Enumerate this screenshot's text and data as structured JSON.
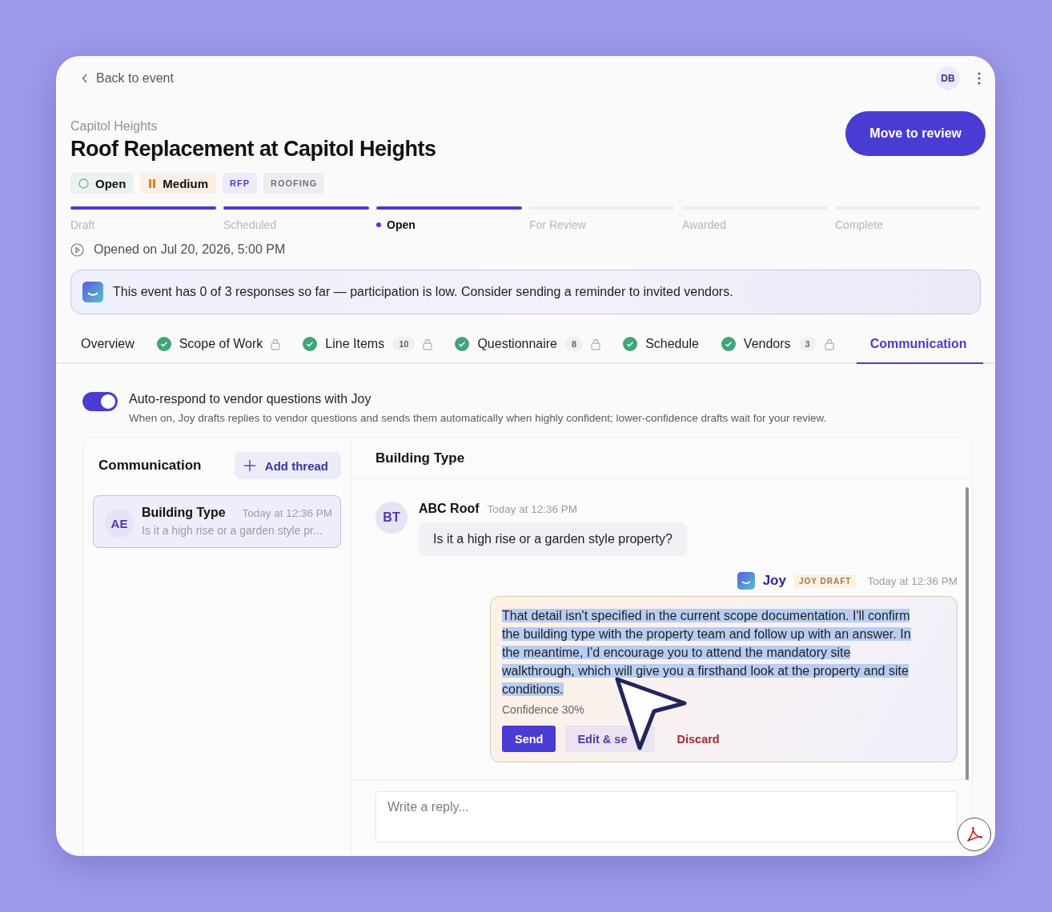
{
  "header": {
    "back": "Back to event",
    "avatar": "DB"
  },
  "event": {
    "breadcrumb": "Capitol Heights",
    "title": "Roof Replacement at Capitol Heights",
    "action": "Move to review"
  },
  "badges": [
    {
      "kind": "status",
      "label": "Open"
    },
    {
      "kind": "priority",
      "label": "Medium"
    },
    {
      "kind": "type",
      "label": "RFP"
    },
    {
      "kind": "category",
      "label": "ROOFING"
    }
  ],
  "stages": [
    {
      "label": "Draft",
      "done": true,
      "selected": false
    },
    {
      "label": "Scheduled",
      "done": true,
      "selected": false
    },
    {
      "label": "Open",
      "done": true,
      "selected": true
    },
    {
      "label": "For Review",
      "done": false,
      "selected": false
    },
    {
      "label": "Awarded",
      "done": false,
      "selected": false
    },
    {
      "label": "Complete",
      "done": false,
      "selected": false
    }
  ],
  "opened": "Opened on Jul 20, 2026, 5:00 PM",
  "alert": "This event has 0 of 3 responses so far — participation is low. Consider sending a reminder to invited vendors.",
  "tabs": [
    {
      "label": "Overview",
      "complete": false,
      "locked": false,
      "selected": false
    },
    {
      "label": "Scope of Work",
      "complete": true,
      "locked": true,
      "selected": false
    },
    {
      "label": "Line Items",
      "complete": true,
      "count": "10",
      "locked": true,
      "selected": false
    },
    {
      "label": "Questionnaire",
      "complete": true,
      "count": "8",
      "locked": true,
      "selected": false
    },
    {
      "label": "Schedule",
      "complete": true,
      "locked": false,
      "selected": false
    },
    {
      "label": "Vendors",
      "complete": true,
      "count": "3",
      "locked": true,
      "selected": false
    },
    {
      "label": "Communication",
      "complete": false,
      "locked": false,
      "selected": true
    }
  ],
  "auto_respond": {
    "on": true,
    "label": "Auto-respond to vendor questions with Joy",
    "hint": "When on, Joy drafts replies to vendor questions and sends them automatically when highly confident; lower-confidence drafts wait for your review."
  },
  "threads_panel": {
    "title": "Communication",
    "add": "Add thread",
    "threads": [
      {
        "avatar": "AE",
        "title": "Building Type",
        "time": "Today at 12:36 PM",
        "preview": "Is it a high rise or a garden style pr...",
        "selected": true
      }
    ]
  },
  "conversation": {
    "title": "Building Type",
    "messages": [
      {
        "kind": "vendor",
        "avatar": "BT",
        "author": "ABC Roof",
        "time": "Today at 12:36 PM",
        "text": "Is it a high rise or a garden style property?"
      },
      {
        "kind": "draft",
        "author": "Joy",
        "badge": "JOY DRAFT",
        "time": "Today at 12:36 PM",
        "text": "That detail isn't specified in the current scope documentation. I'll confirm the building type with the property team and follow up with an answer. In the meantime, I'd encourage you to attend the mandatory site walkthrough, which will give you a firsthand look at the property and site conditions.",
        "highlighted": true,
        "confidence": "Confidence 30%",
        "actions": [
          {
            "kind": "primary",
            "label": "Send"
          },
          {
            "kind": "secondary",
            "label": "Edit & se"
          },
          {
            "kind": "danger",
            "label": "Discard"
          }
        ]
      }
    ],
    "reply": {
      "placeholder": "Write a reply..."
    }
  }
}
